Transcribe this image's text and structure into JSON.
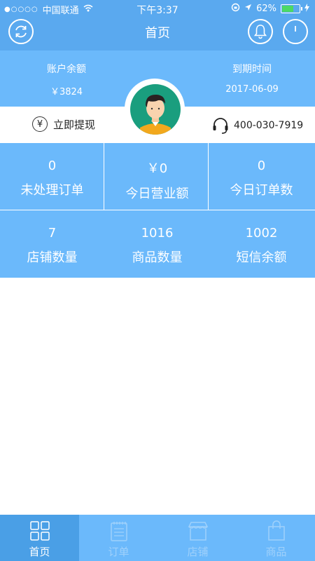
{
  "status_bar": {
    "carrier": "中国联通",
    "time": "下午3:37",
    "battery": "62%",
    "battery_level": 0.62
  },
  "nav": {
    "title": "首页"
  },
  "account": {
    "balance_label": "账户余额",
    "balance_value": "￥3824",
    "expiry_label": "到期时间",
    "expiry_value": "2017-06-09",
    "withdraw_label": "立即提现",
    "phone": "400-030-7919"
  },
  "stats": [
    {
      "value": "0",
      "label": "未处理订单"
    },
    {
      "value": "￥0",
      "label": "今日营业额"
    },
    {
      "value": "0",
      "label": "今日订单数"
    },
    {
      "value": "7",
      "label": "店铺数量"
    },
    {
      "value": "1016",
      "label": "商品数量"
    },
    {
      "value": "1002",
      "label": "短信余额"
    }
  ],
  "tabs": [
    {
      "label": "首页",
      "icon": "grid-icon",
      "active": true
    },
    {
      "label": "订单",
      "icon": "order-list-icon",
      "active": false
    },
    {
      "label": "店铺",
      "icon": "store-icon",
      "active": false
    },
    {
      "label": "商品",
      "icon": "bag-icon",
      "active": false
    }
  ],
  "colors": {
    "nav_bg": "#5aa9ef",
    "panel_bg": "#6bb9fb",
    "active_tab": "#4a9fe6",
    "avatar_bg": "#1a9e7e"
  }
}
